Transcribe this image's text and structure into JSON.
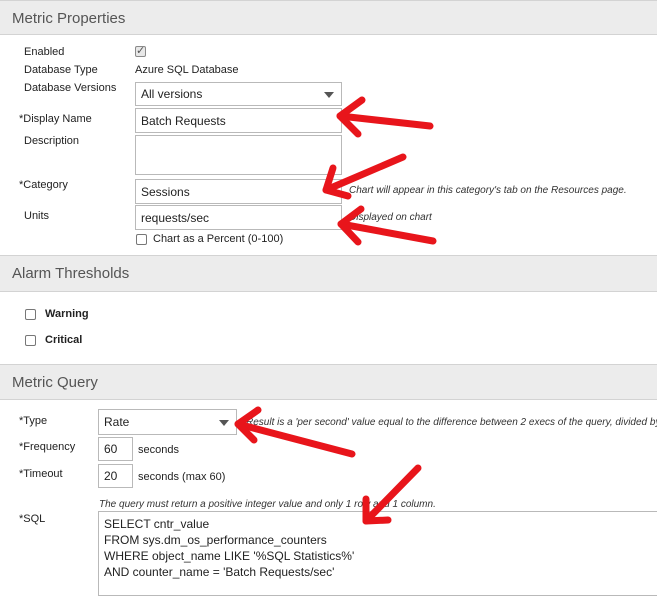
{
  "metric_properties": {
    "header": "Metric Properties",
    "enabled_label": "Enabled",
    "enabled_checked": true,
    "db_type_label": "Database Type",
    "db_type_value": "Azure SQL Database",
    "db_versions_label": "Database Versions",
    "db_versions_value": "All versions",
    "display_name_label": "*Display Name",
    "display_name_value": "Batch Requests",
    "description_label": "Description",
    "description_value": "",
    "category_label": "*Category",
    "category_value": "Sessions",
    "category_hint": "Chart will appear in this category's tab on the Resources page.",
    "units_label": "Units",
    "units_value": "requests/sec",
    "units_hint": "Displayed on chart",
    "chart_percent_label": "Chart as a Percent (0-100)",
    "chart_percent_checked": false
  },
  "alarm_thresholds": {
    "header": "Alarm Thresholds",
    "warning_label": "Warning",
    "critical_label": "Critical"
  },
  "metric_query": {
    "header": "Metric Query",
    "type_label": "*Type",
    "type_value": "Rate",
    "type_hint": "Result is a 'per second' value equal to the difference between 2 execs of the query, divided by",
    "frequency_label": "*Frequency",
    "frequency_value": "60",
    "frequency_unit": "seconds",
    "timeout_label": "*Timeout",
    "timeout_value": "20",
    "timeout_unit": "seconds (max 60)",
    "query_hint": "The query must return a positive integer value and only 1 row and 1 column.",
    "sql_label": "*SQL",
    "sql_lines": [
      "SELECT cntr_value",
      "FROM sys.dm_os_performance_counters",
      "WHERE object_name LIKE '%SQL Statistics%'",
      "AND counter_name = 'Batch Requests/sec'"
    ]
  },
  "colors": {
    "arrow": "#e8151b",
    "header_bg": "#ececec"
  }
}
